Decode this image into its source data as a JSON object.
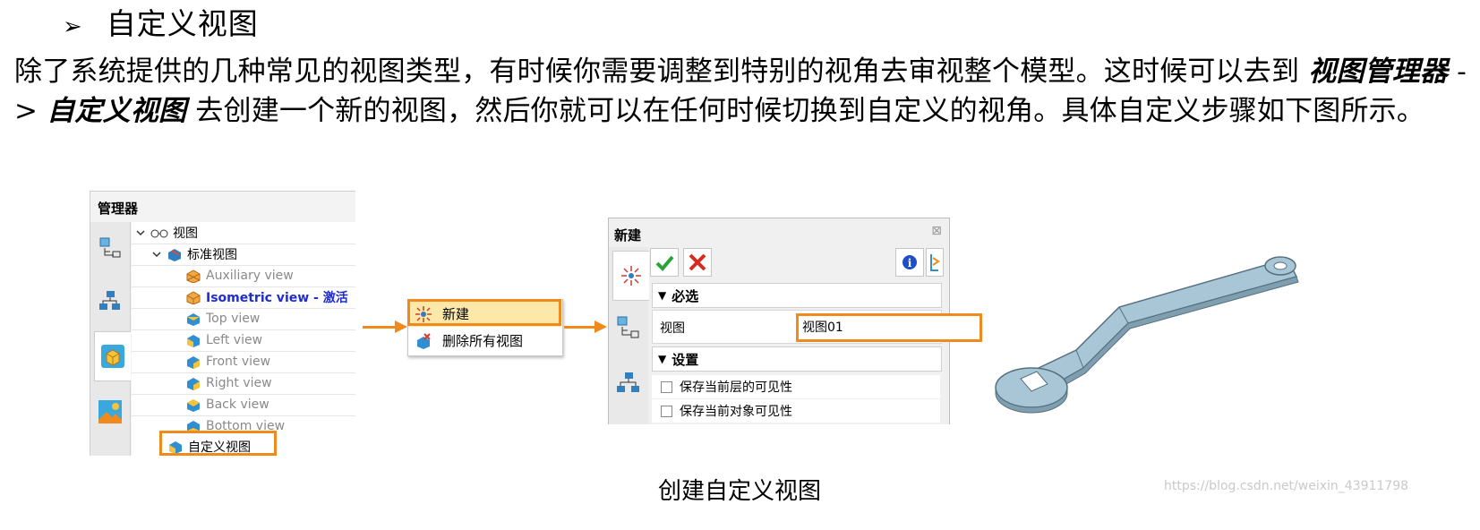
{
  "heading": {
    "bullet": "➢",
    "text": "自定义视图"
  },
  "paragraph": {
    "part1": "除了系统提供的几种常见的视图类型，有时候你需要调整到特别的视角去审视整个模型。这时候可以去到 ",
    "emph1": "视图管理器",
    "arrow": " -> ",
    "emph2": "自定义视图",
    "part2": " 去创建一个新的视图，然后你就可以在任何时候切换到自定义的视角。具体自定义步骤如下图所示。"
  },
  "manager": {
    "title": "管理器",
    "tree": {
      "root": "视图",
      "standard": "标准视图",
      "views": [
        {
          "label": "Auxiliary view",
          "state": "grey"
        },
        {
          "label": "Isometric view - 激活",
          "state": "active"
        },
        {
          "label": "Top view",
          "state": "grey"
        },
        {
          "label": "Left view",
          "state": "grey"
        },
        {
          "label": "Front view",
          "state": "grey"
        },
        {
          "label": "Right view",
          "state": "grey"
        },
        {
          "label": "Back view",
          "state": "grey"
        },
        {
          "label": "Bottom view",
          "state": "grey"
        }
      ],
      "custom": "自定义视图"
    }
  },
  "context_menu": {
    "items": [
      {
        "label": "新建"
      },
      {
        "label": "删除所有视图"
      }
    ]
  },
  "dialog": {
    "title": "新建",
    "close": "⊠",
    "section_required": "必选",
    "field_label": "视图",
    "field_value": "视图01",
    "section_settings": "设置",
    "checkboxes": [
      "保存当前层的可见性",
      "保存当前对象可见性"
    ]
  },
  "caption": "创建自定义视图",
  "watermark": "https://blog.csdn.net/weixin_43911798",
  "colors": {
    "accent": "#f08a1c",
    "active_text": "#1f2ccf",
    "model": "#a9c6d6"
  }
}
